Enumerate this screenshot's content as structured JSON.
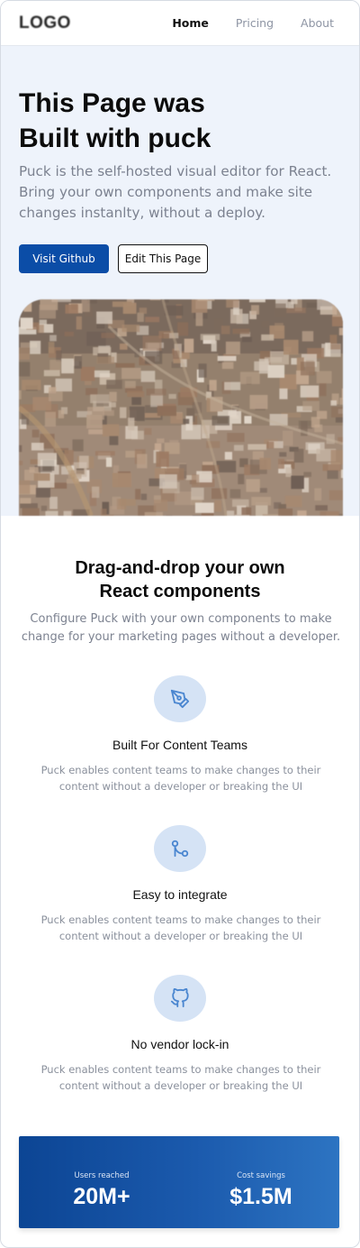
{
  "header": {
    "logo": "LOGO",
    "nav": [
      "Home",
      "Pricing",
      "About"
    ]
  },
  "hero": {
    "title_line1": "This Page was",
    "title_line2": "Built with puck",
    "description": "Puck is the self-hosted visual editor for React. Bring your own components and make site changes instanlty, without a deploy.",
    "primary_button": "Visit Github",
    "secondary_button": "Edit This Page"
  },
  "features": {
    "heading_line1": "Drag-and-drop your own",
    "heading_line2": "React components",
    "intro": "Configure Puck with your own components to make change for your marketing pages without a developer.",
    "items": [
      {
        "icon": "pen-tool-icon",
        "title": "Built For Content Teams",
        "description": "Puck enables content teams to make changes to their content without a developer or breaking the UI"
      },
      {
        "icon": "git-merge-icon",
        "title": "Easy to integrate",
        "description": "Puck enables content teams to make changes to their content without a developer or breaking the UI"
      },
      {
        "icon": "github-icon",
        "title": "No vendor lock-in",
        "description": "Puck enables content teams to make changes to their content without a developer or breaking the UI"
      }
    ]
  },
  "stats": [
    {
      "label": "Users reached",
      "value": "20M+"
    },
    {
      "label": "Cost savings",
      "value": "$1.5M"
    }
  ],
  "colors": {
    "primary": "#0b4da7",
    "hero_bg": "#eef3fb",
    "icon_bg": "#d5e3f5",
    "icon_stroke": "#4a86d0"
  }
}
